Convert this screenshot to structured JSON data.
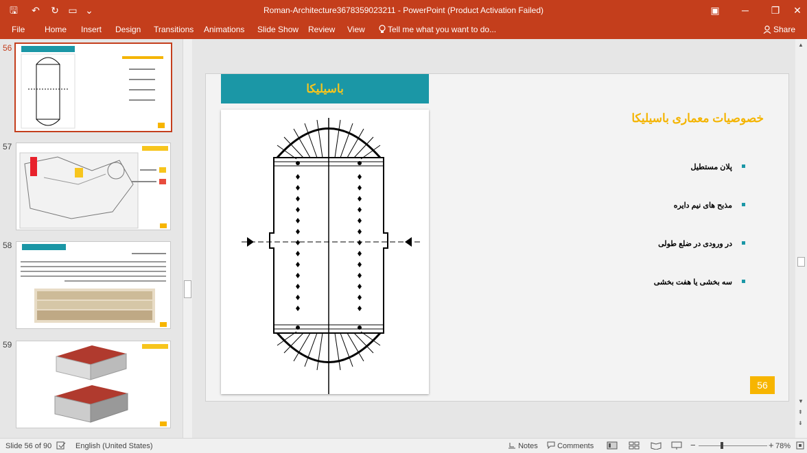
{
  "window": {
    "title": "Roman-Architecture3678359023211 - PowerPoint (Product Activation Failed)",
    "minimize": "─",
    "restore": "❐",
    "close": "✕",
    "ribbon_display": "▣"
  },
  "quick_access": {
    "save_icon": "🖫",
    "undo_icon": "↶",
    "redo_icon": "↻",
    "start_icon": "▭",
    "customize_icon": "⌄"
  },
  "ribbon": {
    "tabs": [
      "File",
      "Home",
      "Insert",
      "Design",
      "Transitions",
      "Animations",
      "Slide Show",
      "Review",
      "View"
    ],
    "tell_me": "Tell me what you want to do...",
    "share": "Share"
  },
  "thumbnails": [
    {
      "number": "56",
      "active": true
    },
    {
      "number": "57",
      "active": false
    },
    {
      "number": "58",
      "active": false
    },
    {
      "number": "59",
      "active": false
    }
  ],
  "slide": {
    "header": "باسیلیکا",
    "title": "خصوصیات معماری باسیلیکا",
    "bullets": [
      "پلان مستطیل",
      "مذبح های نیم دایره",
      "در ورودی در ضلع طولی",
      "سه بخشی یا هفت بخشی"
    ],
    "page_number": "56",
    "accent_color": "#1b97a6",
    "title_color": "#f4b400"
  },
  "status": {
    "slide_info": "Slide 56 of 90",
    "language": "English (United States)",
    "notes": "Notes",
    "comments": "Comments",
    "zoom": "78%"
  }
}
